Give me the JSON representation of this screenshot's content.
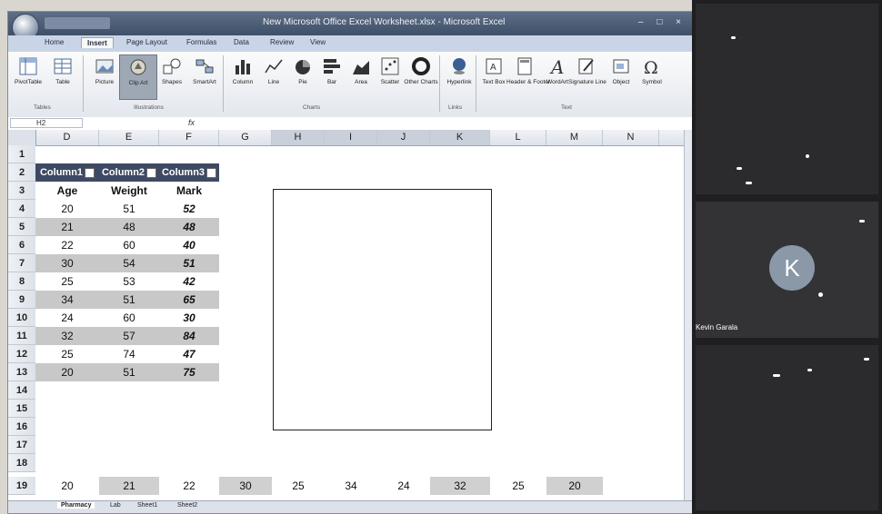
{
  "excel": {
    "title": "New Microsoft Office Excel Worksheet.xlsx - Microsoft Excel",
    "window_buttons": "– □ ×",
    "tabs": [
      "Home",
      "Insert",
      "Page Layout",
      "Formulas",
      "Data",
      "Review",
      "View"
    ],
    "active_tab": "Insert",
    "ribbon": {
      "buttons": [
        "PivotTable",
        "Table",
        "Picture",
        "Clip Art",
        "Shapes",
        "SmartArt",
        "Column",
        "Line",
        "Pie",
        "Bar",
        "Area",
        "Scatter",
        "Other Charts",
        "Hyperlink",
        "Text Box",
        "Header & Footer",
        "WordArt",
        "Signature Line",
        "Object",
        "Symbol"
      ],
      "groups": [
        "Tables",
        "Illustrations",
        "Charts",
        "Links",
        "Text"
      ]
    },
    "name_box": "H2",
    "fx_label": "fx",
    "columns": [
      "D",
      "E",
      "F",
      "G",
      "H",
      "I",
      "J",
      "K",
      "L",
      "M",
      "N"
    ],
    "rows": [
      "1",
      "2",
      "3",
      "4",
      "5",
      "6",
      "7",
      "8",
      "9",
      "10",
      "11",
      "12",
      "13",
      "14",
      "15",
      "16",
      "17",
      "18",
      "19"
    ],
    "table": {
      "headers": [
        "Column1",
        "Column2",
        "Column3"
      ],
      "subheaders": [
        "Age",
        "Weight",
        "Mark"
      ],
      "data": [
        [
          "20",
          "51",
          "52"
        ],
        [
          "21",
          "48",
          "48"
        ],
        [
          "22",
          "60",
          "40"
        ],
        [
          "30",
          "54",
          "51"
        ],
        [
          "25",
          "53",
          "42"
        ],
        [
          "34",
          "51",
          "65"
        ],
        [
          "24",
          "60",
          "30"
        ],
        [
          "32",
          "57",
          "84"
        ],
        [
          "25",
          "74",
          "47"
        ],
        [
          "20",
          "51",
          "75"
        ]
      ]
    },
    "row19_values": [
      "20",
      "21",
      "22",
      "30",
      "25",
      "34",
      "24",
      "32",
      "25",
      "20"
    ],
    "sheet_tabs": [
      "Pharmacy",
      "Lab",
      "Sheet1",
      "Sheet2"
    ],
    "active_sheet": "Pharmacy"
  },
  "meeting": {
    "participant_initial": "K",
    "participant_name": "Kevin Garala",
    "avatar_color": "#8a98a8"
  }
}
